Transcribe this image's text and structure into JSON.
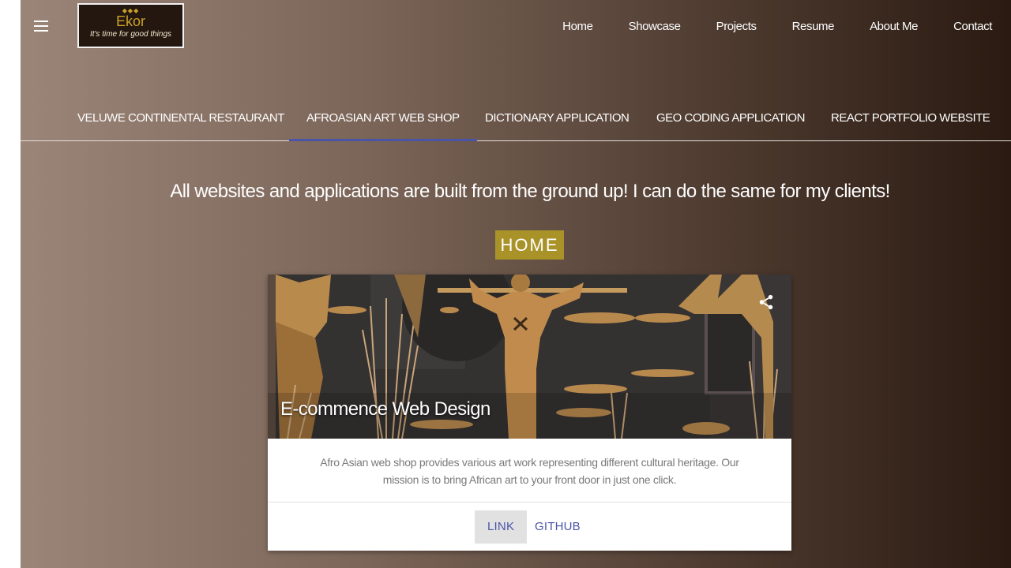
{
  "logo": {
    "brand": "Ekor",
    "tagline": "It's time for good things",
    "diamonds": "◆◆◆"
  },
  "nav": {
    "items": [
      "Home",
      "Showcase",
      "Projects",
      "Resume",
      "About Me",
      "Contact"
    ]
  },
  "tabs": {
    "items": [
      "VELUWE CONTINENTAL RESTAURANT",
      "AFROASIAN ART WEB SHOP",
      "DICTIONARY APPLICATION",
      "GEO CODING APPLICATION",
      "REACT PORTFOLIO WEBSITE"
    ],
    "active_index": 1
  },
  "headline": "All websites and applications are built from the ground up! I can do the same for my clients!",
  "badge": "HOME",
  "card": {
    "title": "E-commence Web Design",
    "description_line1": "Afro Asian web shop provides various art work representing different cultural heritage. Our",
    "description_line2": "mission is to bring African art to your front door in just one click.",
    "link_label": "LINK",
    "github_label": "GITHUB"
  },
  "icons": {
    "menu": "menu-icon",
    "share": "share-icon"
  },
  "colors": {
    "accent": "#4b55a8",
    "badge": "#a99228",
    "logo_bg": "#24170f",
    "logo_text": "#c9a227"
  }
}
